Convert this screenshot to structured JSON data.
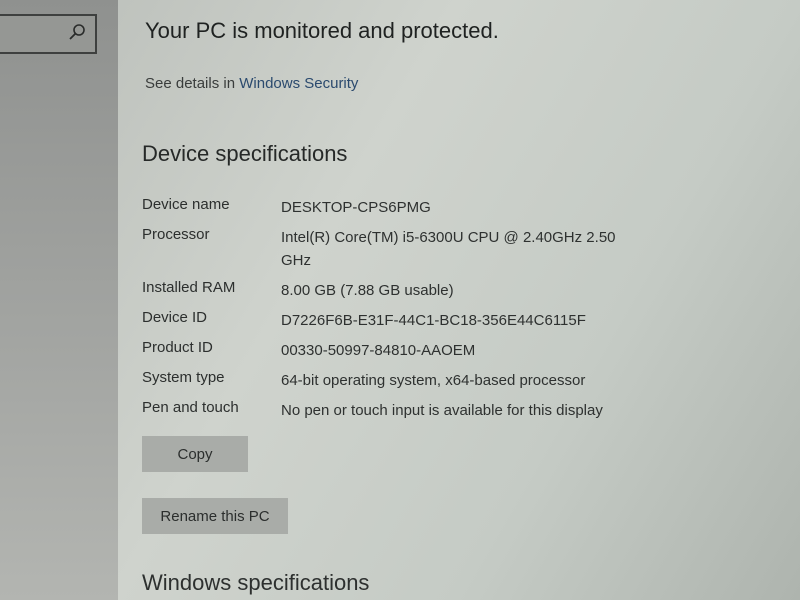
{
  "sidebar": {
    "search_placeholder": "",
    "search_icon": "search-icon"
  },
  "security": {
    "headline": "Your PC is monitored and protected.",
    "details_prefix": "See details in ",
    "details_link": "Windows Security"
  },
  "device_specs": {
    "title": "Device specifications",
    "rows": [
      {
        "label": "Device name",
        "value": "DESKTOP-CPS6PMG"
      },
      {
        "label": "Processor",
        "value": "Intel(R) Core(TM) i5-6300U CPU @ 2.40GHz   2.50 GHz"
      },
      {
        "label": "Installed RAM",
        "value": "8.00 GB (7.88 GB usable)"
      },
      {
        "label": "Device ID",
        "value": "D7226F6B-E31F-44C1-BC18-356E44C6115F"
      },
      {
        "label": "Product ID",
        "value": "00330-50997-84810-AAOEM"
      },
      {
        "label": "System type",
        "value": "64-bit operating system, x64-based processor"
      },
      {
        "label": "Pen and touch",
        "value": "No pen or touch input is available for this display"
      }
    ],
    "copy_label": "Copy",
    "rename_label": "Rename this PC"
  },
  "windows_specs": {
    "title": "Windows specifications"
  }
}
